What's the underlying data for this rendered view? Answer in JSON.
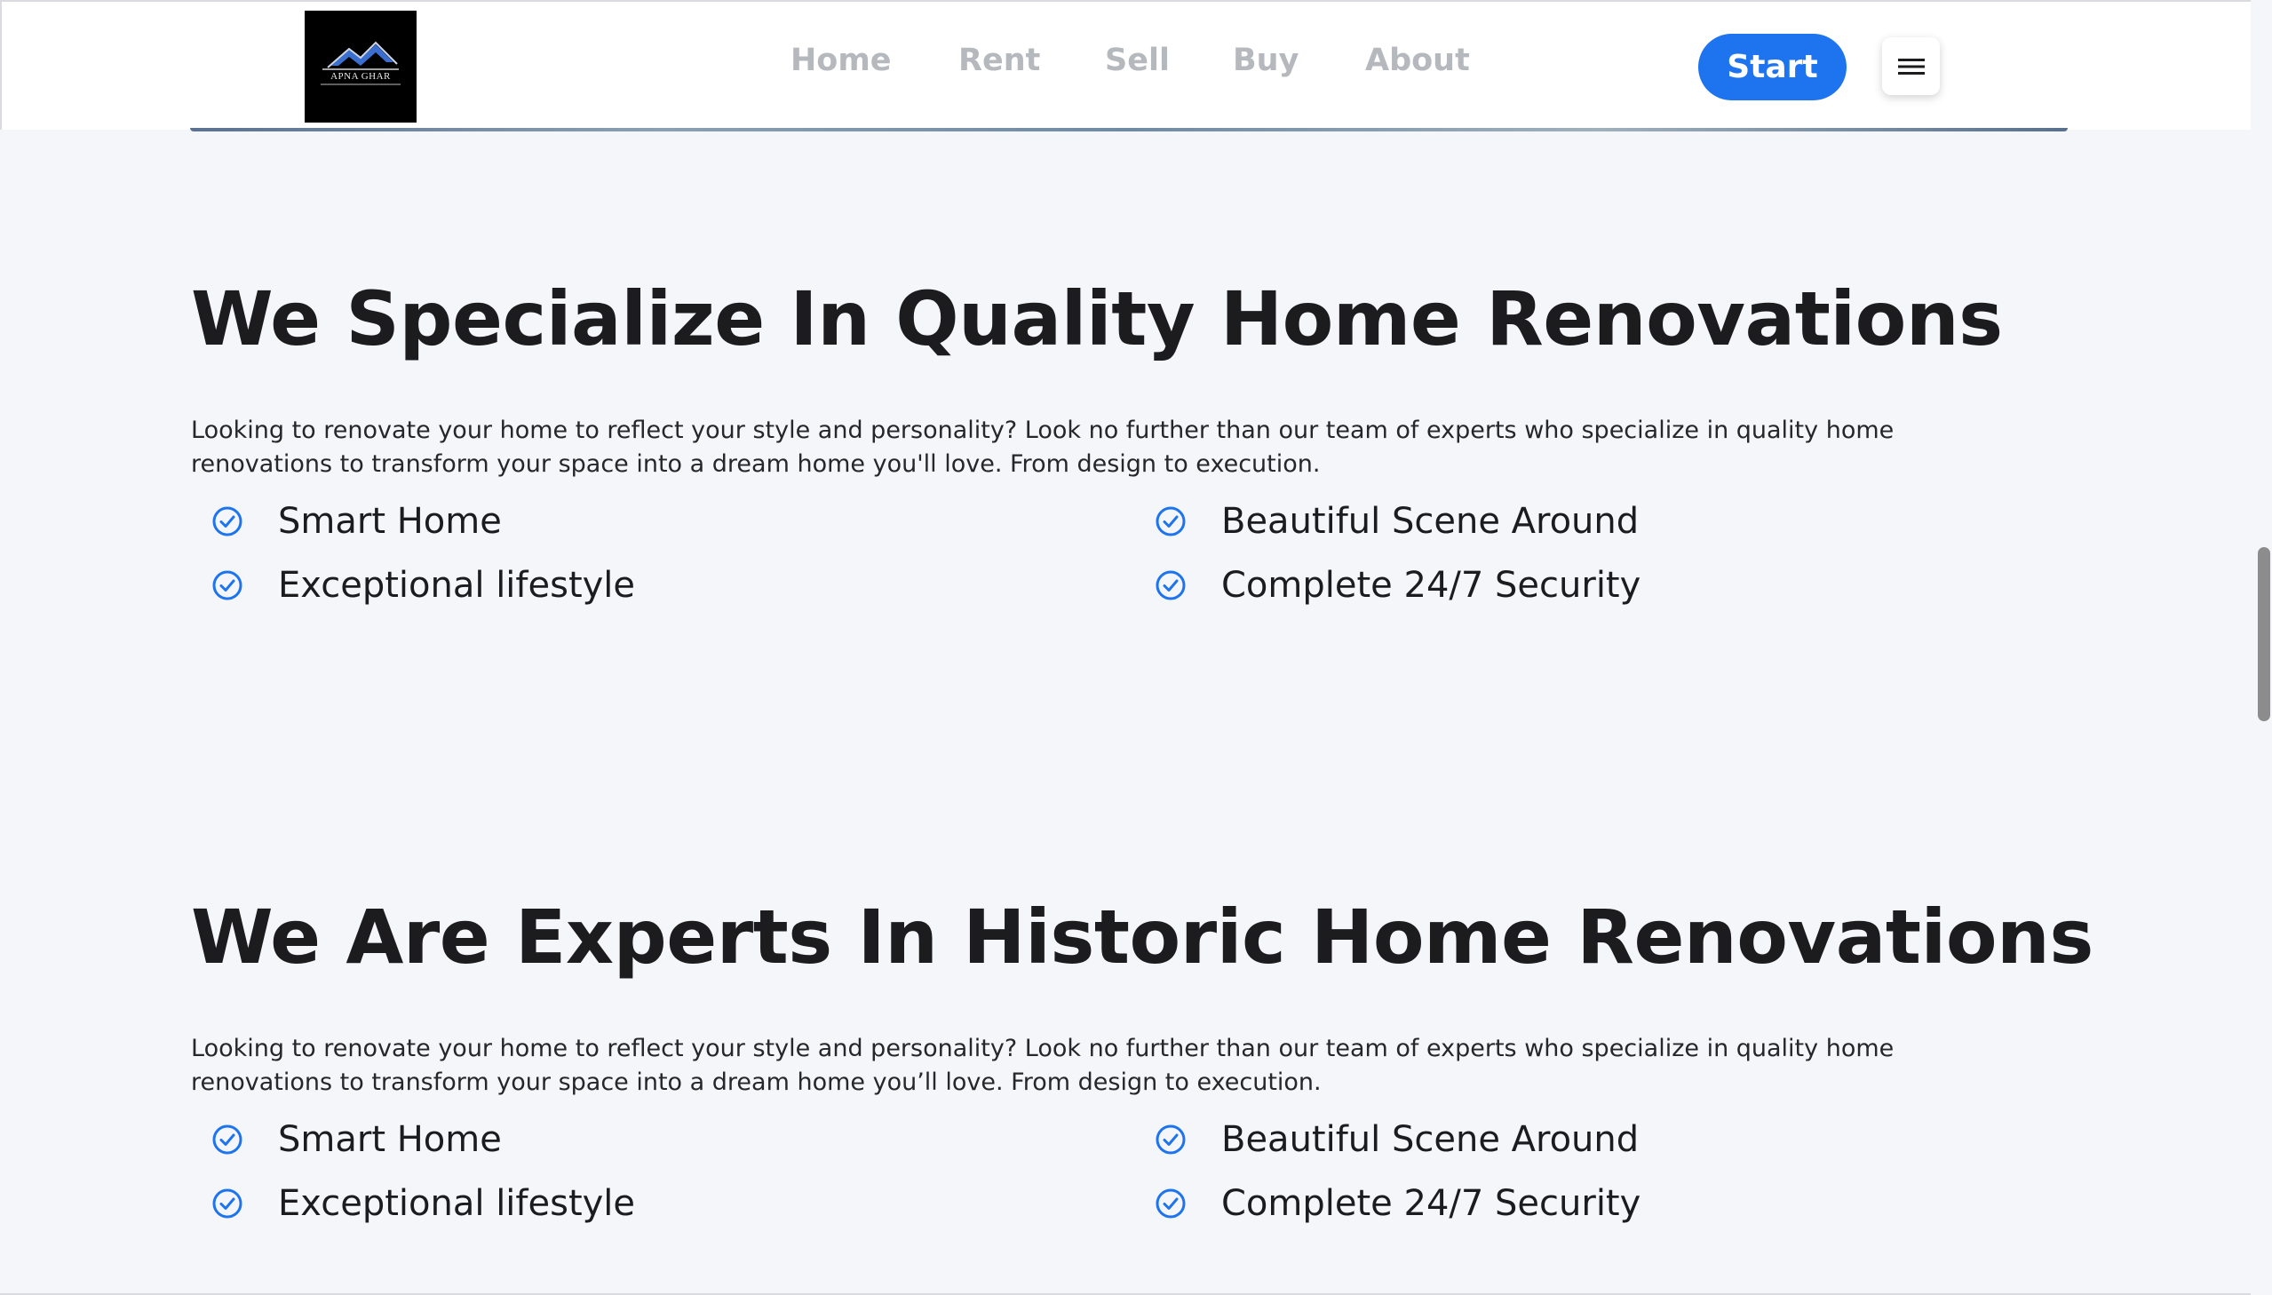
{
  "brand": {
    "logo_text": "APNA GHAR",
    "accent": "#1d74ee"
  },
  "nav": {
    "links": [
      "Home",
      "Rent",
      "Sell",
      "Buy",
      "About"
    ],
    "start_label": "Start",
    "menu_icon": "hamburger-icon"
  },
  "sections": [
    {
      "title": "We Specialize In Quality Home Renovations",
      "description": "Looking to renovate your home to reflect your style and personality? Look no further than our team of experts who specialize in quality home renovations to transform your space into a dream home you'll love. From design to execution.",
      "features": [
        "Smart Home",
        "Beautiful Scene Around",
        "Exceptional lifestyle",
        "Complete 24/7 Security"
      ]
    },
    {
      "title": "We Are Experts In Historic Home Renovations",
      "description": "Looking to renovate your home to reflect your style and personality? Look no further than our team of experts who specialize in quality home renovations to transform your space into a dream home you’ll love. From design to execution.",
      "features": [
        "Smart Home",
        "Beautiful Scene Around",
        "Exceptional lifestyle",
        "Complete 24/7 Security"
      ]
    }
  ]
}
